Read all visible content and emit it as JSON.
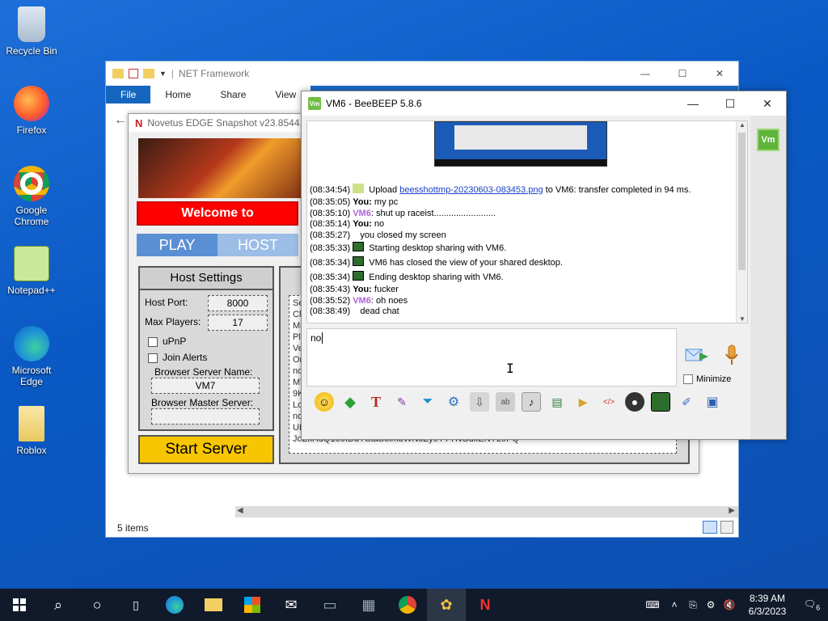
{
  "desktop": {
    "icons": [
      {
        "label": "Recycle Bin"
      },
      {
        "label": "Firefox"
      },
      {
        "label": "Google Chrome"
      },
      {
        "label": "Notepad++"
      },
      {
        "label": "Microsoft Edge"
      },
      {
        "label": "Roblox"
      }
    ]
  },
  "explorer": {
    "title": "NET Framework",
    "tabs": [
      "File",
      "Home",
      "Share",
      "View"
    ],
    "status": "5 items"
  },
  "novetus": {
    "title": "Novetus EDGE Snapshot v23.8544.1",
    "welcome": "Welcome to",
    "tab_play": "PLAY",
    "tab_host": "HOST",
    "host_settings": {
      "title": "Host Settings",
      "host_port_label": "Host Port:",
      "host_port": "8000",
      "max_players_label": "Max Players:",
      "max_players": "17",
      "upnp_label": "uPnP",
      "join_alerts_label": "Join Alerts",
      "browser_server_name_label": "Browser Server Name:",
      "browser_server_name": "VM7",
      "browser_master_label": "Browser Master Server:",
      "browser_master": ""
    },
    "server_text": "Ser\nClie\nMa\nPla\nVer\nOn\nnov\nMT\n9Kl\nLoc\nnov\nUH\nJoZkHdQ109IDdYStaS0imbWN0Zy9YTYNGdlIENYL9PQ==",
    "start_server": "Start Server"
  },
  "beebeep": {
    "title": "VM6 - BeeBEEP 5.8.6",
    "icon_text": "Vm",
    "chat": [
      {
        "time": "(08:34:54)",
        "kind": "upload",
        "pre": " Upload ",
        "link": "beesshottmp-20230603-083453.png",
        "post": " to VM6: transfer completed in 94 ms."
      },
      {
        "time": "(08:35:05)",
        "kind": "msg",
        "who": "You:",
        "who_class": "you",
        "text": " my pc"
      },
      {
        "time": "(08:35:10)",
        "kind": "msg",
        "who": "VM6",
        "who_class": "vm6",
        "text": ": shut up raceist........................."
      },
      {
        "time": "(08:35:14)",
        "kind": "msg",
        "who": "You:",
        "who_class": "you",
        "text": " no"
      },
      {
        "time": "(08:35:27)",
        "kind": "plain",
        "text": "   you closed my screen"
      },
      {
        "time": "(08:35:33)",
        "kind": "sys",
        "text": " Starting desktop sharing with VM6."
      },
      {
        "time": "(08:35:34)",
        "kind": "sys",
        "text": " VM6 has closed the view of your shared desktop."
      },
      {
        "time": "(08:35:34)",
        "kind": "sys",
        "text": " Ending desktop sharing with VM6."
      },
      {
        "time": "(08:35:43)",
        "kind": "msg",
        "who": "You:",
        "who_class": "you",
        "text": " fucker"
      },
      {
        "time": "(08:35:52)",
        "kind": "msg",
        "who": "VM6",
        "who_class": "vm6",
        "text": ": oh noes"
      },
      {
        "time": "(08:38:49)",
        "kind": "plain",
        "text": "   dead chat"
      }
    ],
    "input_value": "no",
    "minimize_label": "Minimize",
    "avatar_text": "Vm"
  },
  "taskbar": {
    "time": "8:39 AM",
    "date": "6/3/2023",
    "notification_count": "6"
  }
}
